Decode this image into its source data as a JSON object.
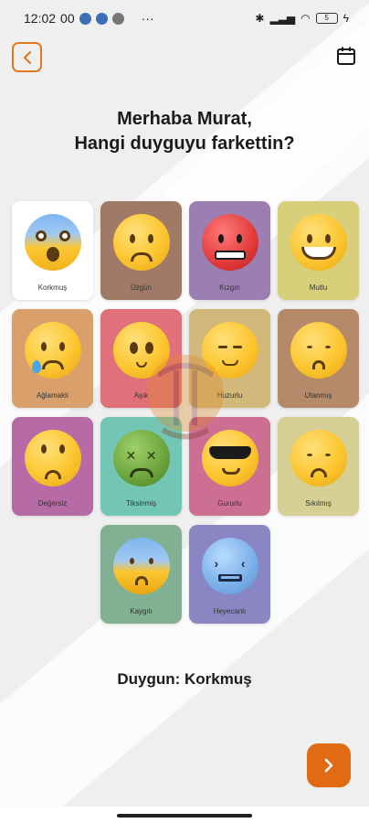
{
  "status_bar": {
    "time": "12:02",
    "network_speed": "00",
    "more": "···",
    "battery": "5"
  },
  "header": {
    "greeting_line1": "Merhaba Murat,",
    "greeting_line2": "Hangi duyguyu farkettin?"
  },
  "emotions": [
    {
      "label": "Korkmuş",
      "color": "#ffffff",
      "icon": "scared-face-icon"
    },
    {
      "label": "Üzgün",
      "color": "#a07a66",
      "icon": "sad-face-icon"
    },
    {
      "label": "Kızgın",
      "color": "#9b7fb3",
      "icon": "angry-face-icon"
    },
    {
      "label": "Mutlu",
      "color": "#d7cf7a",
      "icon": "grinning-face-icon"
    },
    {
      "label": "Ağlamaklı",
      "color": "#d9a06c",
      "icon": "crying-face-icon"
    },
    {
      "label": "Aşık",
      "color": "#e0707a",
      "icon": "smitten-face-icon"
    },
    {
      "label": "Huzurlu",
      "color": "#d2b87a",
      "icon": "relieved-face-icon"
    },
    {
      "label": "Utanmış",
      "color": "#b48a6a",
      "icon": "ashamed-face-icon"
    },
    {
      "label": "Değersiz",
      "color": "#b66aa6",
      "icon": "eye-roll-face-icon"
    },
    {
      "label": "Tiksinmiş",
      "color": "#74c6b4",
      "icon": "disgusted-face-icon"
    },
    {
      "label": "Gururlu",
      "color": "#cc6f93",
      "icon": "sunglasses-face-icon"
    },
    {
      "label": "Sıkılmış",
      "color": "#d6cf93",
      "icon": "bored-face-icon"
    },
    {
      "label": "Kaygılı",
      "color": "#82b093",
      "icon": "anxious-face-icon"
    },
    {
      "label": "Heyecanlı",
      "color": "#8a86c4",
      "icon": "excited-face-icon"
    }
  ],
  "selection": {
    "text": "Duygun: Korkmuş"
  },
  "colors": {
    "accent": "#e06b14",
    "back_border": "#e07a22"
  }
}
